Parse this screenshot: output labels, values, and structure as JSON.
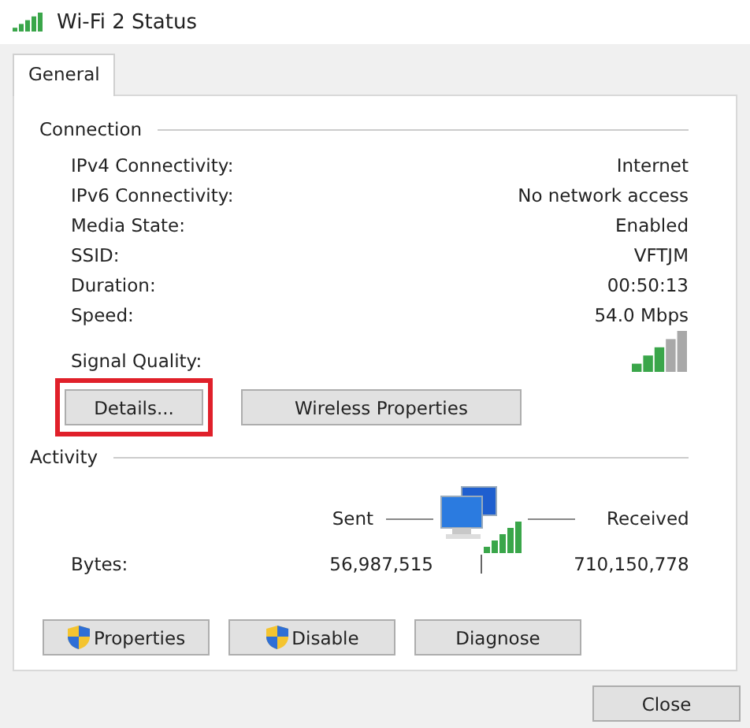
{
  "window": {
    "title": "Wi-Fi 2 Status"
  },
  "tabs": [
    {
      "label": "General",
      "selected": true
    }
  ],
  "connection": {
    "heading": "Connection",
    "rows": [
      {
        "label": "IPv4 Connectivity:",
        "value": "Internet"
      },
      {
        "label": "IPv6 Connectivity:",
        "value": "No network access"
      },
      {
        "label": "Media State:",
        "value": "Enabled"
      },
      {
        "label": "SSID:",
        "value": "VFTJM"
      },
      {
        "label": "Duration:",
        "value": "00:50:13"
      },
      {
        "label": "Speed:",
        "value": "54.0 Mbps"
      }
    ],
    "signal_label": "Signal Quality:",
    "buttons": [
      {
        "label": "Details...",
        "highlighted": true
      },
      {
        "label": "Wireless Properties",
        "highlighted": false
      }
    ]
  },
  "activity": {
    "heading": "Activity",
    "sent_label": "Sent",
    "received_label": "Received",
    "bytes_label": "Bytes:",
    "sent": "56,987,515",
    "received": "710,150,778",
    "buttons": [
      {
        "label": "Properties",
        "kind": "shield"
      },
      {
        "label": "Disable",
        "kind": "shield"
      },
      {
        "label": "Diagnose",
        "kind": "plain"
      }
    ]
  },
  "close_button": "Close"
}
